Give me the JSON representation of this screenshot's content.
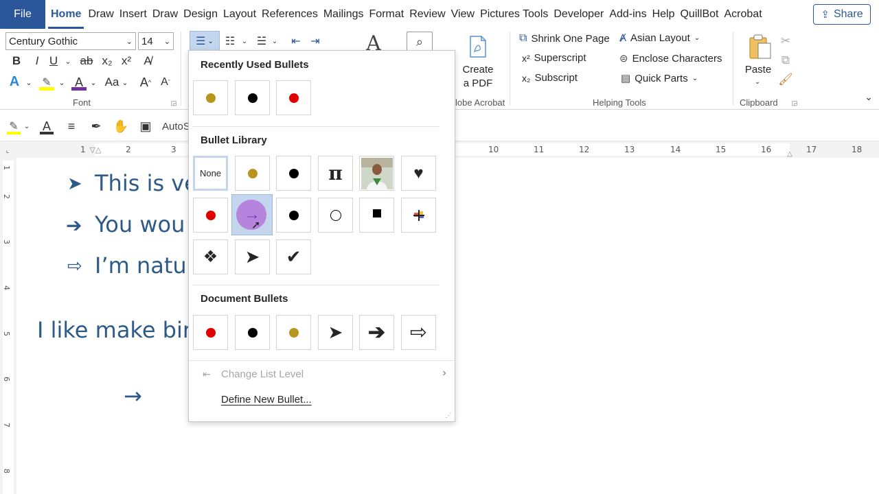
{
  "tabs": {
    "file": "File",
    "items": [
      "Home",
      "Draw",
      "Insert",
      "Draw",
      "Design",
      "Layout",
      "References",
      "Mailings",
      "Format",
      "Review",
      "View",
      "Pictures Tools",
      "Developer",
      "Add-ins",
      "Help",
      "QuillBot",
      "Acrobat"
    ],
    "active_index": 0,
    "share": "Share"
  },
  "ribbon": {
    "font_name": "Century Gothic",
    "font_size": "14",
    "font_group_label": "Font",
    "create_pdf_line1": "Create",
    "create_pdf_line2": "a PDF",
    "adobe_group_label": "lobe Acrobat",
    "helping_tools": {
      "shrink": "Shrink One Page",
      "superscript": "Superscript",
      "subscript": "Subscript",
      "asian_layout": "Asian Layout",
      "enclose": "Enclose Characters",
      "quick_parts": "Quick Parts",
      "group_label": "Helping Tools"
    },
    "clipboard": {
      "paste": "Paste",
      "group_label": "Clipboard"
    },
    "font_buttons": {
      "bold": "B",
      "italic": "I",
      "underline": "U",
      "strike": "ab",
      "subscript": "x₂",
      "superscript": "x²",
      "change_case": "Aa",
      "grow": "A",
      "shrink": "A"
    }
  },
  "toolbar2": {
    "autosum_label": "AutoS"
  },
  "ruler": {
    "numbers": [
      "1",
      "2",
      "3",
      "10",
      "11",
      "12",
      "13",
      "14",
      "15",
      "16",
      "17",
      "18"
    ],
    "vertical_numbers": [
      "1",
      "2",
      "3",
      "4",
      "5",
      "6",
      "7",
      "8"
    ]
  },
  "document": {
    "line1": "This is ver",
    "line2": "You wou",
    "line3": "I’m natur",
    "line4": "I like make bir",
    "arrow_line": "→"
  },
  "gallery": {
    "recently_used_title": "Recently Used Bullets",
    "library_title": "Bullet Library",
    "document_title": "Document Bullets",
    "none_label": "None",
    "recent_colors": [
      "#b8961e",
      "#000000",
      "#e00000"
    ],
    "change_list_level": "Change List Level",
    "define_new_bullet": "Define New Bullet..."
  }
}
